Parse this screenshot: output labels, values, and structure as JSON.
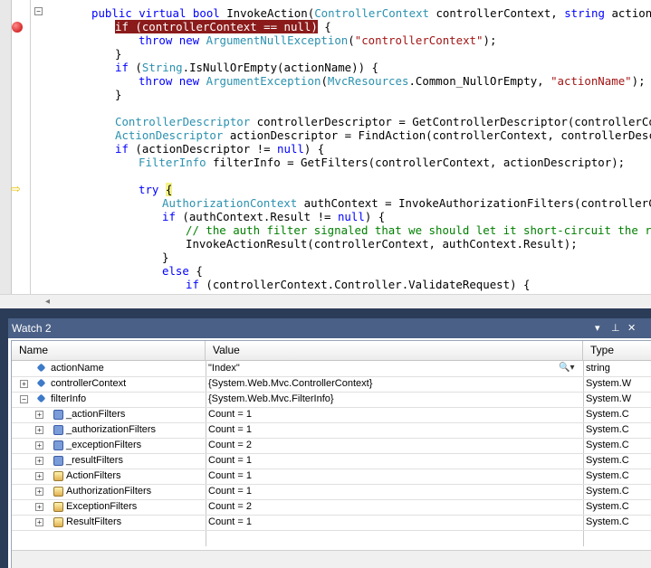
{
  "editor": {
    "lines": [
      {
        "i": 0,
        "segs": [
          [
            "kw",
            "public virtual bool "
          ],
          [
            "",
            "InvokeAction("
          ],
          [
            "ty",
            "ControllerContext"
          ],
          [
            "",
            " controllerContext, "
          ],
          [
            "kw",
            "string"
          ],
          [
            "",
            " actionName) {"
          ]
        ]
      },
      {
        "i": 1,
        "segs": [
          [
            "bp",
            "if (controllerContext == null)"
          ],
          [
            "",
            " {"
          ]
        ]
      },
      {
        "i": 2,
        "segs": [
          [
            "kw",
            "throw new "
          ],
          [
            "ty",
            "ArgumentNullException"
          ],
          [
            "",
            "("
          ],
          [
            "st",
            "\"controllerContext\""
          ],
          [
            "",
            ");"
          ]
        ]
      },
      {
        "i": 1,
        "segs": [
          [
            "",
            "}"
          ]
        ]
      },
      {
        "i": 1,
        "segs": [
          [
            "kw",
            "if "
          ],
          [
            "",
            "("
          ],
          [
            "ty",
            "String"
          ],
          [
            "",
            ".IsNullOrEmpty(actionName)) {"
          ]
        ]
      },
      {
        "i": 2,
        "segs": [
          [
            "kw",
            "throw new "
          ],
          [
            "ty",
            "ArgumentException"
          ],
          [
            "",
            "("
          ],
          [
            "ty",
            "MvcResources"
          ],
          [
            "",
            ".Common_NullOrEmpty, "
          ],
          [
            "st",
            "\"actionName\""
          ],
          [
            "",
            ");"
          ]
        ]
      },
      {
        "i": 1,
        "segs": [
          [
            "",
            "}"
          ]
        ]
      },
      {
        "i": 1,
        "segs": [
          [
            "",
            ""
          ]
        ]
      },
      {
        "i": 1,
        "segs": [
          [
            "ty",
            "ControllerDescriptor"
          ],
          [
            "",
            " controllerDescriptor = GetControllerDescriptor(controllerContext);"
          ]
        ]
      },
      {
        "i": 1,
        "segs": [
          [
            "ty",
            "ActionDescriptor"
          ],
          [
            "",
            " actionDescriptor = FindAction(controllerContext, controllerDescriptor, act"
          ]
        ]
      },
      {
        "i": 1,
        "segs": [
          [
            "kw",
            "if "
          ],
          [
            "",
            "(actionDescriptor != "
          ],
          [
            "kw",
            "null"
          ],
          [
            "",
            ") {"
          ]
        ]
      },
      {
        "i": 2,
        "segs": [
          [
            "ty",
            "FilterInfo"
          ],
          [
            "",
            " filterInfo = GetFilters(controllerContext, actionDescriptor);"
          ]
        ]
      },
      {
        "i": 2,
        "segs": [
          [
            "",
            ""
          ]
        ]
      },
      {
        "i": 2,
        "segs": [
          [
            "kw",
            "try "
          ],
          [
            "cur",
            "{"
          ]
        ]
      },
      {
        "i": 3,
        "segs": [
          [
            "ty",
            "AuthorizationContext"
          ],
          [
            "",
            " authContext = InvokeAuthorizationFilters(controllerContext, fi"
          ]
        ]
      },
      {
        "i": 3,
        "segs": [
          [
            "kw",
            "if "
          ],
          [
            "",
            "(authContext.Result != "
          ],
          [
            "kw",
            "null"
          ],
          [
            "",
            ") {"
          ]
        ]
      },
      {
        "i": 4,
        "segs": [
          [
            "cm",
            "// the auth filter signaled that we should let it short-circuit the request"
          ]
        ]
      },
      {
        "i": 4,
        "segs": [
          [
            "",
            "InvokeActionResult(controllerContext, authContext.Result);"
          ]
        ]
      },
      {
        "i": 3,
        "segs": [
          [
            "",
            "}"
          ]
        ]
      },
      {
        "i": 3,
        "segs": [
          [
            "kw",
            "else "
          ],
          [
            "",
            "{"
          ]
        ]
      },
      {
        "i": 4,
        "segs": [
          [
            "kw",
            "if "
          ],
          [
            "",
            "(controllerContext.Controller.ValidateRequest) {"
          ]
        ]
      }
    ]
  },
  "watch": {
    "title": "Watch 2",
    "columns": {
      "name": "Name",
      "value": "Value",
      "type": "Type"
    },
    "rows": [
      {
        "depth": 0,
        "expander": "",
        "icon": "field",
        "name": "actionName",
        "value": "\"Index\"",
        "type": "string"
      },
      {
        "depth": 0,
        "expander": "+",
        "icon": "field",
        "name": "controllerContext",
        "value": "{System.Web.Mvc.ControllerContext}",
        "type": "System.W"
      },
      {
        "depth": 0,
        "expander": "-",
        "icon": "field",
        "name": "filterInfo",
        "value": "{System.Web.Mvc.FilterInfo}",
        "type": "System.W"
      },
      {
        "depth": 1,
        "expander": "+",
        "icon": "key",
        "name": "_actionFilters",
        "value": "Count = 1",
        "type": "System.C"
      },
      {
        "depth": 1,
        "expander": "+",
        "icon": "key",
        "name": "_authorizationFilters",
        "value": "Count = 1",
        "type": "System.C"
      },
      {
        "depth": 1,
        "expander": "+",
        "icon": "key",
        "name": "_exceptionFilters",
        "value": "Count = 2",
        "type": "System.C"
      },
      {
        "depth": 1,
        "expander": "+",
        "icon": "key",
        "name": "_resultFilters",
        "value": "Count = 1",
        "type": "System.C"
      },
      {
        "depth": 1,
        "expander": "+",
        "icon": "prop",
        "name": "ActionFilters",
        "value": "Count = 1",
        "type": "System.C"
      },
      {
        "depth": 1,
        "expander": "+",
        "icon": "prop",
        "name": "AuthorizationFilters",
        "value": "Count = 1",
        "type": "System.C"
      },
      {
        "depth": 1,
        "expander": "+",
        "icon": "prop",
        "name": "ExceptionFilters",
        "value": "Count = 2",
        "type": "System.C"
      },
      {
        "depth": 1,
        "expander": "+",
        "icon": "prop",
        "name": "ResultFilters",
        "value": "Count = 1",
        "type": "System.C"
      }
    ]
  },
  "toolbar_glyphs": {
    "dropdown": "▾",
    "pin": "⊥",
    "close": "✕",
    "search": "🔍▾"
  }
}
